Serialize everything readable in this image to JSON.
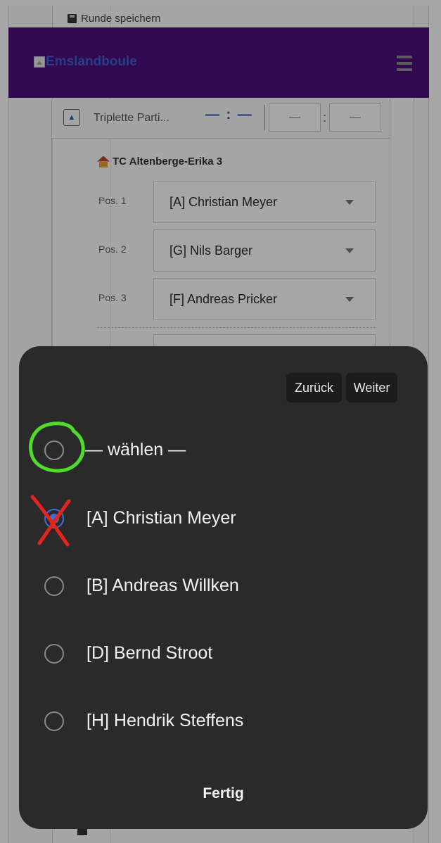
{
  "page": {
    "save_round_label": "Runde speichern",
    "brand": "Emslandboule",
    "match_title": "Triplette Parti...",
    "score_display": "— : —",
    "score_home_placeholder": "—",
    "score_away_placeholder": "—",
    "team_name": "TC Altenberge-Erika 3",
    "positions": [
      {
        "label": "Pos. 1",
        "player": "[A] Christian Meyer"
      },
      {
        "label": "Pos. 2",
        "player": "[G] Nils Barger"
      },
      {
        "label": "Pos. 3",
        "player": "[F] Andreas Pricker"
      }
    ]
  },
  "picker": {
    "back_label": "Zurück",
    "next_label": "Weiter",
    "options": [
      {
        "label": "— wählen —",
        "selected": false
      },
      {
        "label": "[A] Christian Meyer",
        "selected": true
      },
      {
        "label": "[B] Andreas Willken",
        "selected": false
      },
      {
        "label": "[D] Bernd Stroot",
        "selected": false
      },
      {
        "label": "[H] Hendrik Steffens",
        "selected": false
      }
    ],
    "done_label": "Fertig"
  },
  "annotations": {
    "green_circle_color": "#4fdc2a",
    "red_cross_color": "#e6231f"
  },
  "colors": {
    "navbar": "#4b0f7c",
    "brand_text": "#3c5fd2",
    "sheet_bg": "#2a2a2a",
    "radio_selected": "#3b6fd6"
  }
}
